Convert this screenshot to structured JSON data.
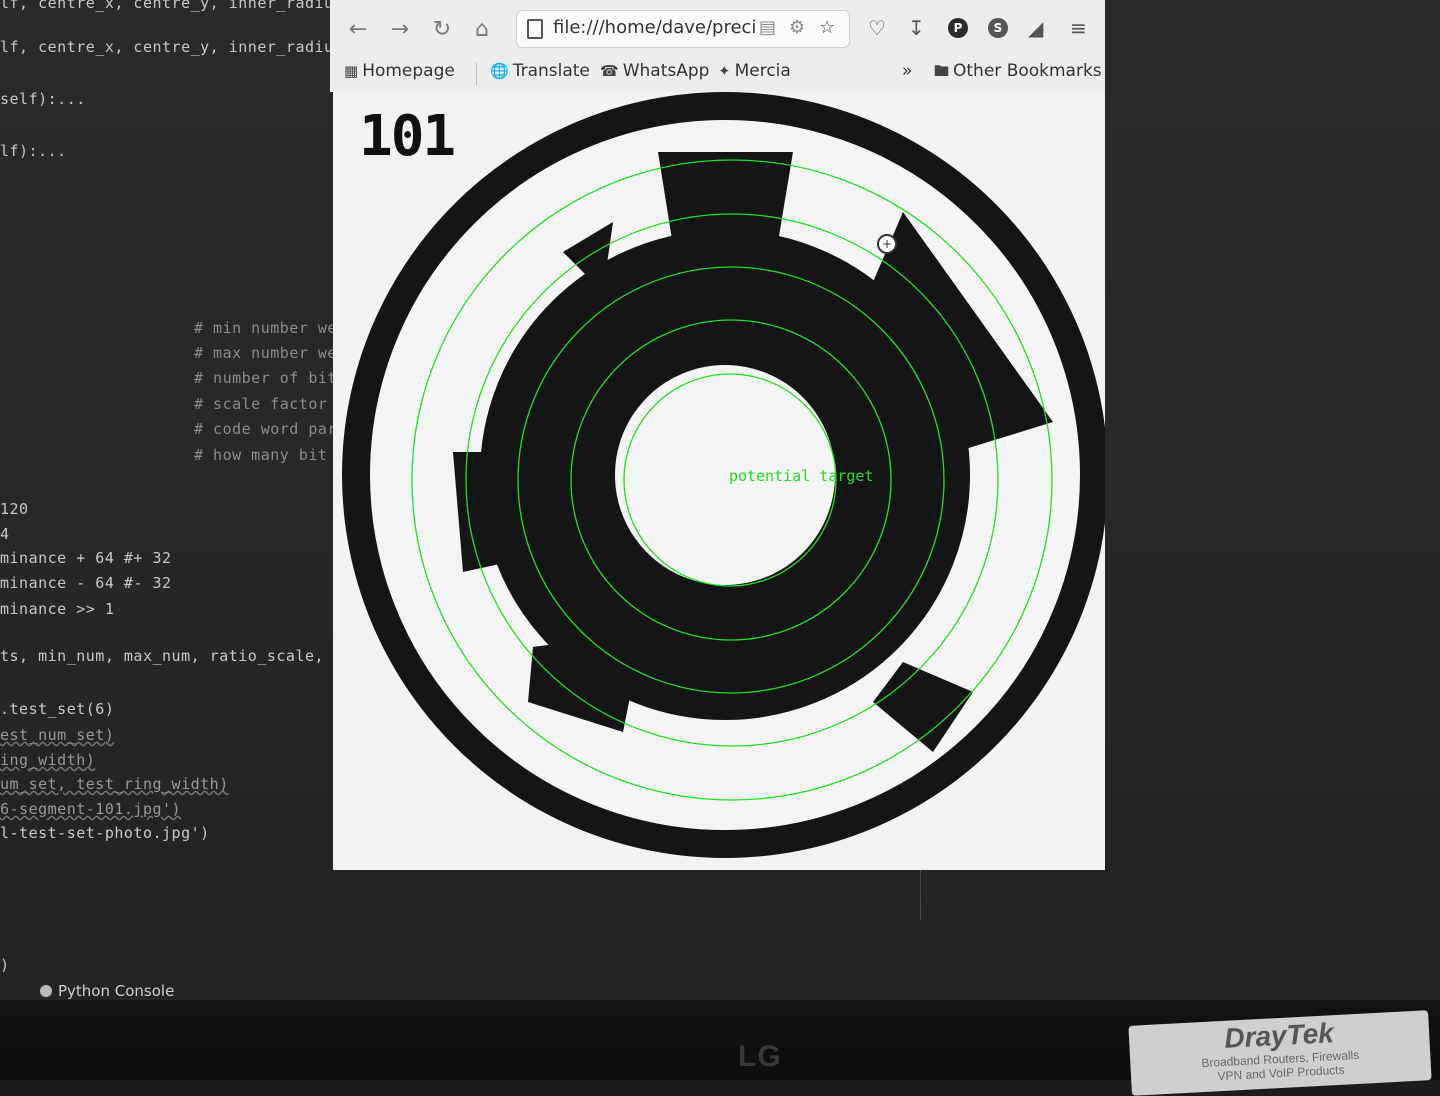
{
  "ide": {
    "code_lines": [
      "lf, centre_x, centre_y, inner_radiu",
      "self):...",
      "lf):...",
      "# min number we",
      "# max number we",
      "# number of bit",
      "# scale factor",
      "# code word par",
      "# how many bit",
      "120",
      "4",
      "minance + 64 #+ 32",
      "minance - 64 #- 32",
      "minance >> 1",
      "ts, min_num, max_num, ratio_scale, pa",
      ".test_set(6)",
      "est_num_set)",
      "ing_width)",
      "um_set, test_ring_width)",
      "6-segment-101.jpg')",
      "l-test-set-photo.jpg')",
      ")"
    ],
    "status_tab": "Python Console"
  },
  "browser": {
    "url": "file:///home/dave/preci",
    "bookmarks": {
      "homepage": "Homepage",
      "translate": "Translate",
      "whatsapp": "WhatsApp",
      "mercia": "Mercia",
      "other": "Other Bookmarks"
    }
  },
  "page": {
    "title": "101",
    "overlay_label": "potential target",
    "overlay_color": "#20e020"
  },
  "monitor": {
    "brand": "LG",
    "sticker_brand": "DrayTek",
    "sticker_line1": "Broadband Routers, Firewalls",
    "sticker_line2": "VPN and VoIP Products"
  }
}
